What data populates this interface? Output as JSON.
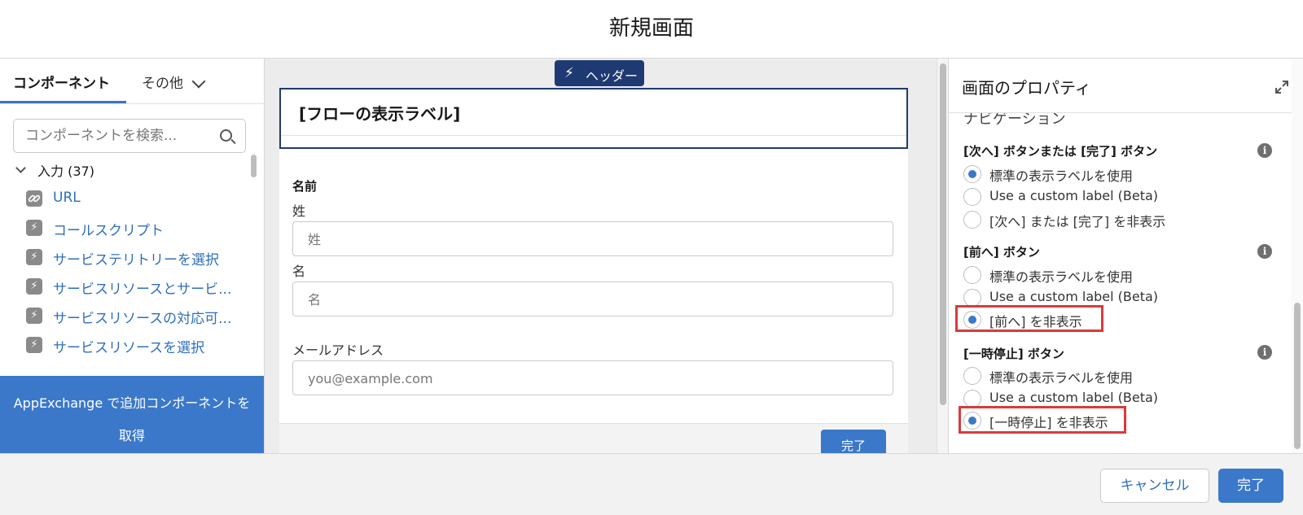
{
  "window": {
    "title": "新規画面"
  },
  "left_panel": {
    "tabs": {
      "components": "コンポーネント",
      "more": "その他"
    },
    "search_placeholder": "コンポーネントを検索...",
    "section_label": "入力 (37)",
    "components": [
      {
        "label": "URL",
        "icon": "link-icon"
      },
      {
        "label": "コールスクリプト",
        "icon": "bolt-icon"
      },
      {
        "label": "サービステリトリーを選択",
        "icon": "bolt-icon"
      },
      {
        "label": "サービスリソースとサービ...",
        "icon": "bolt-icon"
      },
      {
        "label": "サービスリソースの対応可...",
        "icon": "bolt-icon"
      },
      {
        "label": "サービスリソースを選択",
        "icon": "bolt-icon"
      }
    ],
    "appexchange": "AppExchange で追加コンポーネントを取得"
  },
  "canvas": {
    "header_badge": "ヘッダー",
    "header_text": "[フローの表示ラベル]",
    "name_group": "名前",
    "last_name_label": "姓",
    "last_name_placeholder": "姓",
    "first_name_label": "名",
    "first_name_placeholder": "名",
    "email_label": "メールアドレス",
    "email_placeholder": "you@example.com",
    "done_preview": "完了"
  },
  "right_panel": {
    "title": "画面のプロパティ",
    "navigation_heading": "ナビゲーション",
    "groups": [
      {
        "title": "[次へ] ボタンまたは [完了] ボタン",
        "options": [
          {
            "label": "標準の表示ラベルを使用",
            "selected": true
          },
          {
            "label": "Use a custom label (Beta)",
            "selected": false
          },
          {
            "label": "[次へ] または [完了] を非表示",
            "selected": false
          }
        ]
      },
      {
        "title": "[前へ] ボタン",
        "options": [
          {
            "label": "標準の表示ラベルを使用",
            "selected": false
          },
          {
            "label": "Use a custom label (Beta)",
            "selected": false
          },
          {
            "label": "[前へ] を非表示",
            "selected": true
          }
        ]
      },
      {
        "title": "[一時停止] ボタン",
        "options": [
          {
            "label": "標準の表示ラベルを使用",
            "selected": false
          },
          {
            "label": "Use a custom label (Beta)",
            "selected": false
          },
          {
            "label": "[一時停止] を非表示",
            "selected": true
          }
        ]
      }
    ]
  },
  "footer": {
    "cancel": "キャンセル",
    "done": "完了"
  },
  "colors": {
    "accent": "#3b78c9",
    "header_badge": "#1f3a73",
    "highlight": "#d83b3b"
  }
}
